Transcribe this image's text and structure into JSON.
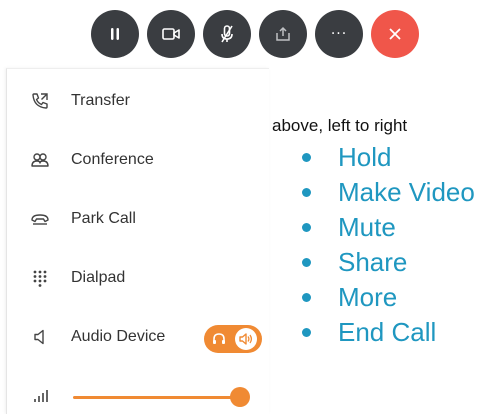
{
  "controls": [
    {
      "name": "hold",
      "icon": "pause-icon"
    },
    {
      "name": "make-video",
      "icon": "video-camera-icon"
    },
    {
      "name": "mute",
      "icon": "microphone-muted-icon"
    },
    {
      "name": "share",
      "icon": "share-icon"
    },
    {
      "name": "more",
      "icon": "more-dots-icon",
      "label": "···"
    },
    {
      "name": "end-call",
      "icon": "close-icon",
      "color": "#f0564a"
    }
  ],
  "menu": {
    "items": [
      {
        "label": "Transfer",
        "icon": "call-transfer-icon"
      },
      {
        "label": "Conference",
        "icon": "conference-icon"
      },
      {
        "label": "Park Call",
        "icon": "park-call-icon"
      },
      {
        "label": "Dialpad",
        "icon": "dialpad-icon"
      },
      {
        "label": "Audio Device",
        "icon": "speaker-icon"
      }
    ],
    "audio_toggle": {
      "options": [
        "headset-icon",
        "speaker-icon"
      ],
      "selected": "speaker-icon"
    },
    "volume": {
      "icon": "signal-bars-icon",
      "level": 0.95
    }
  },
  "annotation": {
    "caption": "above, left to right",
    "items": [
      "Hold",
      "Make Video",
      "Mute",
      "Share",
      "More",
      "End Call"
    ]
  },
  "colors": {
    "control_bg": "#3a3d41",
    "end_call": "#f0564a",
    "accent": "#f08a33",
    "legend_text": "#1f97c0"
  }
}
